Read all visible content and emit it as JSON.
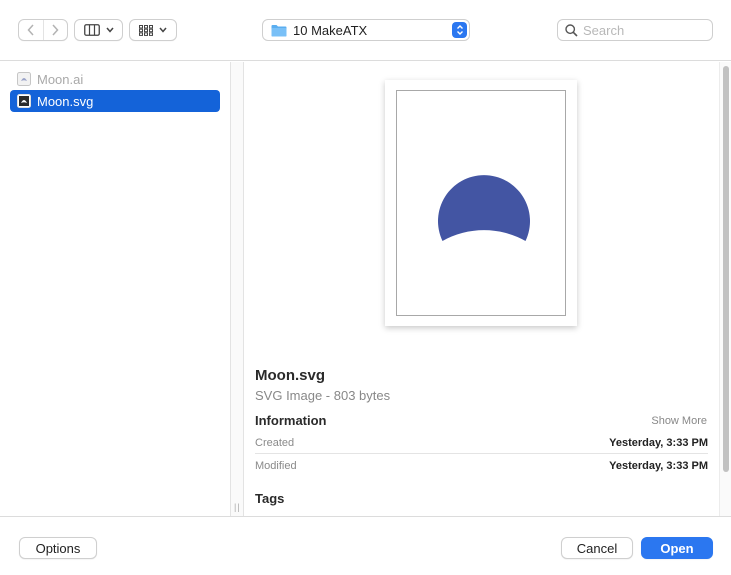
{
  "toolbar": {
    "back_icon": "chevron-left-icon",
    "forward_icon": "chevron-right-icon",
    "view_mode_icon": "columns-view-icon",
    "group_icon": "grid-icon",
    "location_label": "10 MakeATX",
    "search_placeholder": "Search"
  },
  "files": [
    {
      "name": "Moon.ai",
      "state": "disabled"
    },
    {
      "name": "Moon.svg",
      "state": "selected"
    }
  ],
  "preview": {
    "name": "Moon.svg",
    "kind": "SVG Image - 803 bytes",
    "information_heading": "Information",
    "show_more": "Show More",
    "rows": [
      {
        "label": "Created",
        "value": "Yesterday, 3:33 PM"
      },
      {
        "label": "Modified",
        "value": "Yesterday, 3:33 PM"
      }
    ],
    "tags_heading": "Tags",
    "moon_color": "#4355a3"
  },
  "footer": {
    "options_label": "Options",
    "cancel_label": "Cancel",
    "open_label": "Open"
  },
  "colors": {
    "accent": "#2b77f0",
    "selection": "#1463d9"
  }
}
